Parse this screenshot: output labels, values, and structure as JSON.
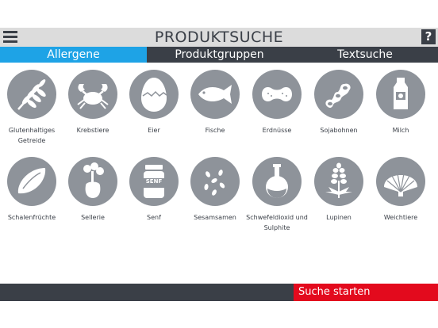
{
  "header": {
    "title": "PRODUKTSUCHE",
    "help_label": "?"
  },
  "tabs": [
    {
      "label": "Allergene",
      "active": true
    },
    {
      "label": "Produktgruppen",
      "active": false
    },
    {
      "label": "Textsuche",
      "active": false
    }
  ],
  "allergens": [
    {
      "label": "Glutenhaltiges Getreide",
      "icon": "grain-icon"
    },
    {
      "label": "Krebstiere",
      "icon": "crab-icon"
    },
    {
      "label": "Eier",
      "icon": "egg-icon"
    },
    {
      "label": "Fische",
      "icon": "fish-icon"
    },
    {
      "label": "Erdnüsse",
      "icon": "peanut-icon"
    },
    {
      "label": "Sojabohnen",
      "icon": "soybean-icon"
    },
    {
      "label": "Milch",
      "icon": "milk-bottle-icon"
    },
    {
      "label": "Schalenfrüchte",
      "icon": "almond-icon"
    },
    {
      "label": "Sellerie",
      "icon": "celery-icon"
    },
    {
      "label": "Senf",
      "icon": "mustard-jar-icon"
    },
    {
      "label": "Sesamsamen",
      "icon": "sesame-seeds-icon"
    },
    {
      "label": "Schwefeldioxid und Sulphite",
      "icon": "flask-icon"
    },
    {
      "label": "Lupinen",
      "icon": "lupine-flower-icon"
    },
    {
      "label": "Weichtiere",
      "icon": "shell-icon"
    }
  ],
  "icon_text": {
    "mustard_jar": "SENF"
  },
  "footer": {
    "search_label": "Suche starten"
  },
  "colors": {
    "active_tab": "#1ea3e6",
    "dark": "#3a3f47",
    "icon_bg": "#8e939a",
    "search": "#e30a1d"
  }
}
